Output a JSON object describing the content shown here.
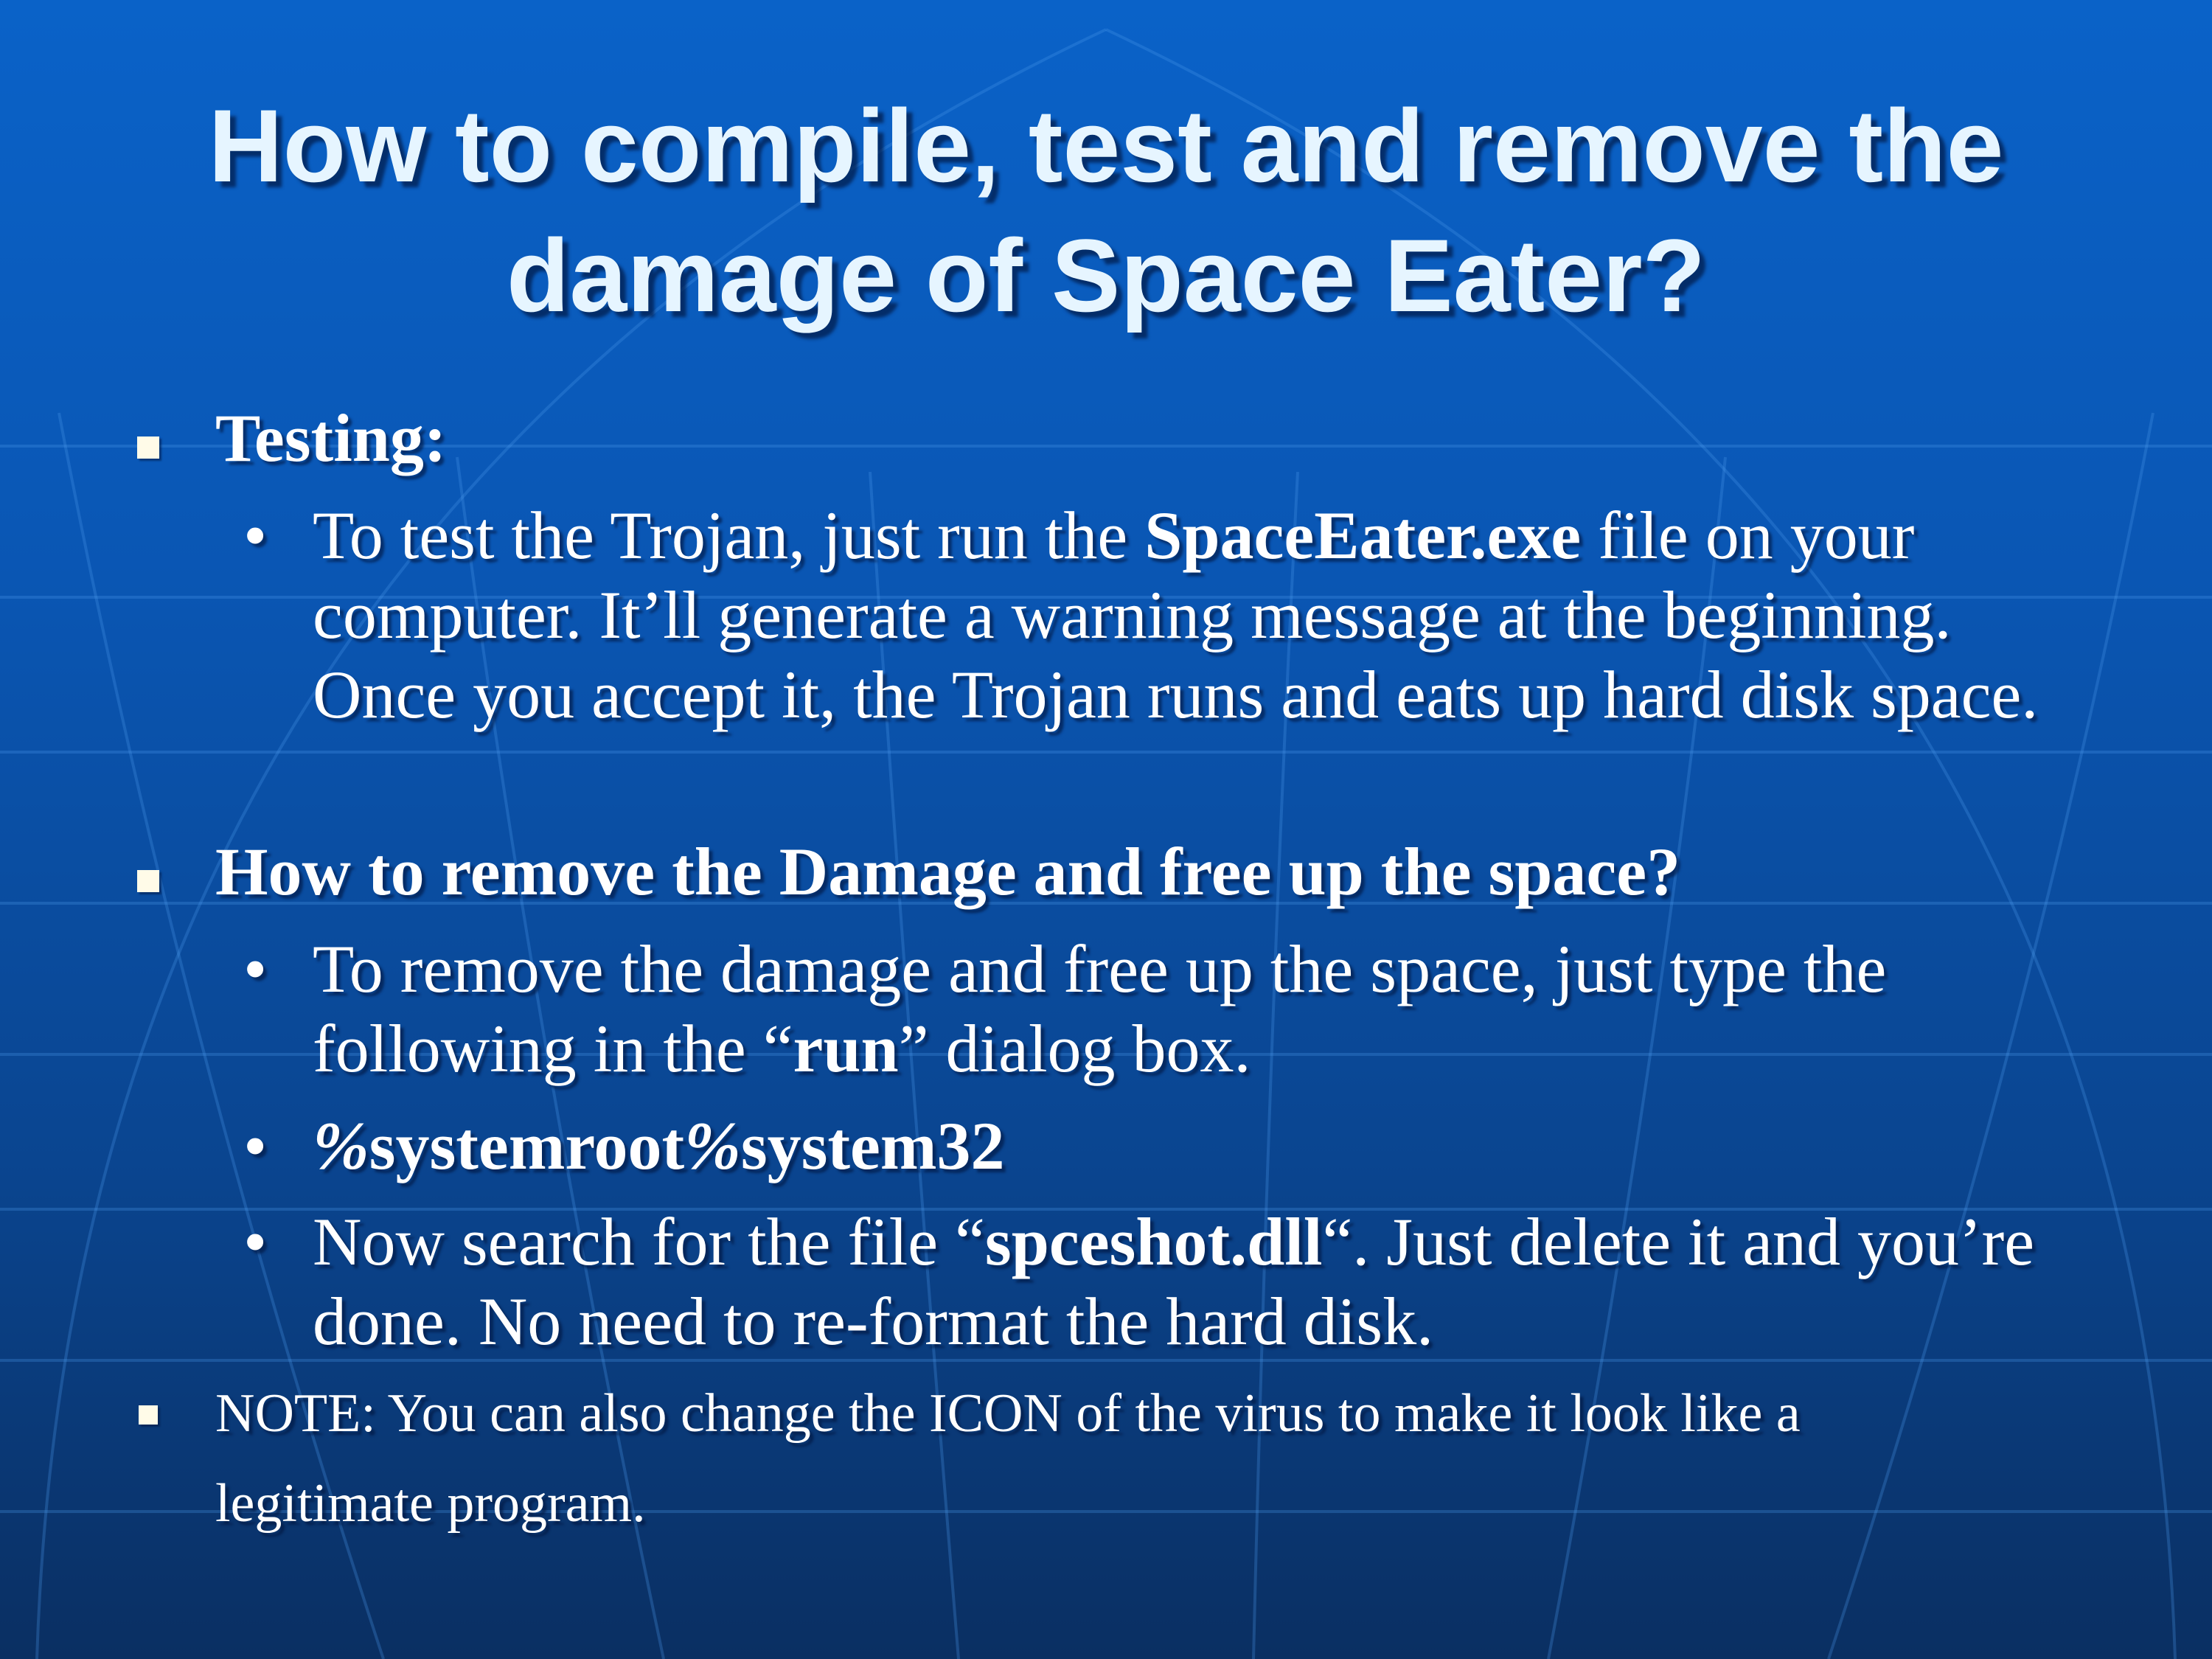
{
  "slide": {
    "title": "How to compile, test and remove the\ndamage of Space Eater?",
    "sections": [
      {
        "heading": "Testing:",
        "items": [
          {
            "pre": "To test the Trojan,  just run the ",
            "bold": "SpaceEater.exe",
            "post": " file on your computer. It’ll generate a warning message at the beginning. Once you accept it, the Trojan runs and eats up hard disk space."
          }
        ]
      },
      {
        "heading": "How to remove the Damage and free up the space?",
        "items": [
          {
            "pre": "To remove the damage and free up the space, just type the following in the “",
            "bold": "run",
            "post": "” dialog box."
          },
          {
            "pct1": "%",
            "word1": "systemroot",
            "pct2": "%",
            "word2": "system32"
          },
          {
            "pre": "Now search for the file “",
            "bold": "spceshot.dll",
            "post": "“. Just delete it and you’re done. No need to re-format the hard disk."
          }
        ]
      }
    ],
    "note": "NOTE: You can also change the ICON of the virus to make it look like a legitimate program."
  },
  "colors": {
    "background_top": "#0a62c8",
    "background_bottom": "#0a2f62",
    "title": "#e6f5ff",
    "body_text": "#ffffff",
    "bullet": "#fffbe8"
  }
}
